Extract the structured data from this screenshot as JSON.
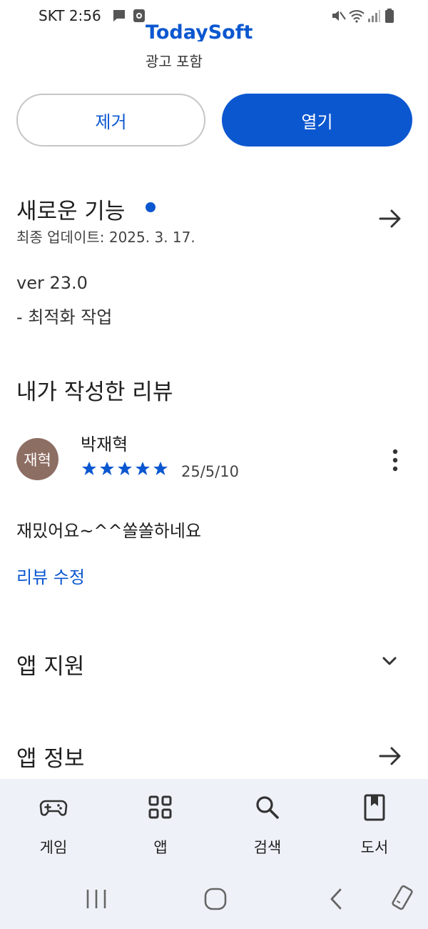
{
  "status_bar": {
    "carrier_time": "SKT 2:56"
  },
  "app": {
    "name": "TodaySoft",
    "ad_label": "광고 포함"
  },
  "actions": {
    "uninstall_label": "제거",
    "open_label": "열기"
  },
  "whats_new": {
    "title": "새로운 기능",
    "last_updated": "최종 업데이트: 2025. 3. 17.",
    "version": "ver 23.0",
    "note": "- 최적화 작업"
  },
  "my_review": {
    "title": "내가 작성한 리뷰",
    "avatar_text": "재혁",
    "reviewer": "박재혁",
    "rating": 5,
    "date": "25/5/10",
    "text": "재밌어요~^^쏠쏠하네요",
    "edit_link": "리뷰 수정"
  },
  "sections": {
    "app_support": "앱 지원",
    "app_info": "앱 정보"
  },
  "bottom_nav": {
    "items": [
      {
        "label": "게임",
        "icon": "gamepad-icon"
      },
      {
        "label": "앱",
        "icon": "apps-grid-icon"
      },
      {
        "label": "검색",
        "icon": "search-icon"
      },
      {
        "label": "도서",
        "icon": "book-icon"
      }
    ]
  },
  "colors": {
    "accent": "#0b57d0",
    "avatar": "#8d6e63",
    "nav_bg": "#eef2f8"
  }
}
